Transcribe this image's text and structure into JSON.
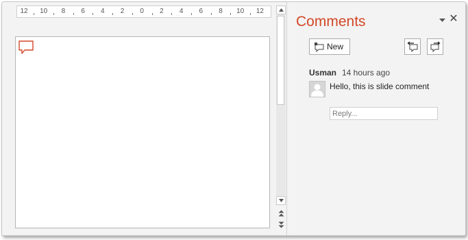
{
  "ruler": {
    "labels": [
      "12",
      "10",
      "8",
      "6",
      "4",
      "2",
      "0",
      "2",
      "4",
      "6",
      "8",
      "10",
      "12"
    ]
  },
  "comments_pane": {
    "title": "Comments",
    "new_button_label": "New",
    "menu_icon": "dropdown-arrow-icon",
    "close_glyph": "✕",
    "previous_icon": "previous-comment-icon",
    "next_icon": "next-comment-icon",
    "comment": {
      "author": "Usman",
      "timestamp": "14 hours ago",
      "text": "Hello, this is slide comment"
    },
    "reply_placeholder": "Reply..."
  },
  "colors": {
    "accent": "#d24726",
    "pane_background": "#f3f3f3",
    "slide_border": "#b5b5b5"
  }
}
